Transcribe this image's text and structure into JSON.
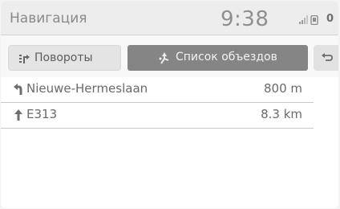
{
  "header": {
    "title": "Навигация",
    "clock": "9:38",
    "status": {
      "signal_icon": "signal-bars-icon",
      "phone_icon": "phone-icon",
      "count": "0"
    }
  },
  "tabs": {
    "turns": {
      "label": "Повороты",
      "icon": "turn-list-icon",
      "selected": false
    },
    "detour": {
      "label": "Список объездов",
      "icon": "detour-icon",
      "selected": true
    },
    "back": {
      "icon": "back-arrow-icon"
    }
  },
  "routes": [
    {
      "street": "Nieuwe-Hermeslaan",
      "distance": "800 m",
      "maneuver": "bear-left"
    },
    {
      "street": "E313",
      "distance": "8.3 km",
      "maneuver": "straight"
    }
  ],
  "colors": {
    "header_bg": "#ededed",
    "active_tab": "#858585",
    "text": "#6a6a6a",
    "divider": "#c8c8c8"
  }
}
